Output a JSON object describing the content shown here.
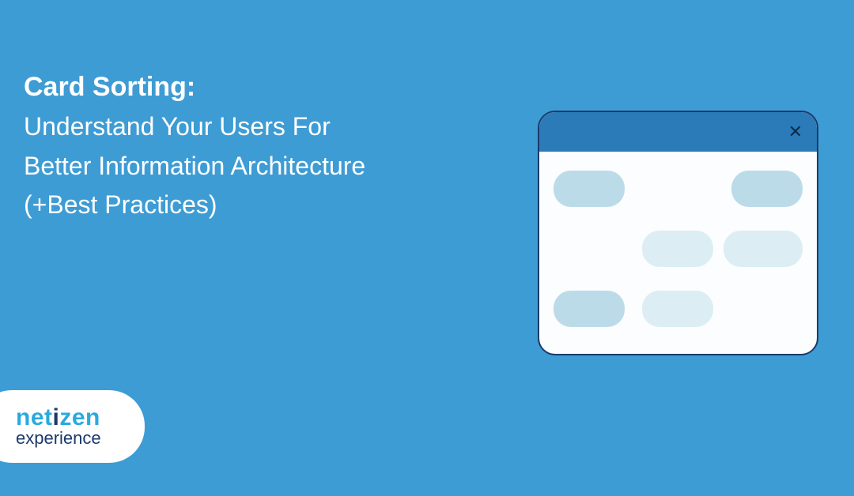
{
  "title": {
    "heading": "Card Sorting:",
    "line1": "Understand Your Users For",
    "line2": "Better Information Architecture",
    "line3": "(+Best Practices)"
  },
  "logo": {
    "word_top": "netizen",
    "word_bottom": "experience"
  },
  "colors": {
    "bg": "#3e9cd4",
    "logo_blue": "#2aa9e0",
    "logo_dark": "#1b3a6b",
    "window_border": "#1b3a6b",
    "window_titlebar": "#2a7bb8",
    "chip_blue": "#bcdbe8",
    "chip_lite": "#dceef3"
  },
  "window": {
    "close_glyph": "✕"
  }
}
